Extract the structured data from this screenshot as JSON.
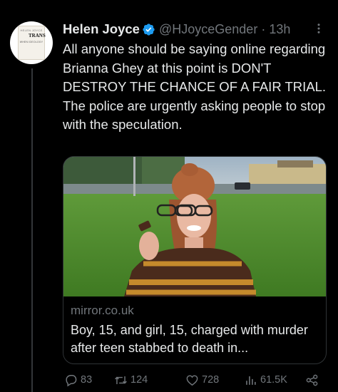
{
  "author": {
    "display_name": "Helen Joyce",
    "handle": "@HJoyceGender",
    "separator": "·",
    "time_ago": "13h",
    "verified": true,
    "avatar": {
      "book_top": "HELEN JOYCE",
      "book_title": "TRANS",
      "book_bottom": "WHEN IDEOLOGY"
    }
  },
  "tweet": {
    "text": "All anyone should be saying online regarding Brianna Ghey at this point is DON'T DESTROY THE CHANCE OF A FAIR TRIAL. The police are urgently asking people to stop with the speculation."
  },
  "card": {
    "domain": "mirror.co.uk",
    "title": "Boy, 15, and girl, 15, charged with murder after teen stabbed to death in..."
  },
  "actions": {
    "replies": "83",
    "retweets": "124",
    "likes": "728",
    "views": "61.5K"
  },
  "colors": {
    "background": "#000000",
    "text": "#e7e9ea",
    "muted": "#71767b",
    "verified": "#1d9bf0",
    "border": "#2f3336"
  },
  "icons": [
    "verified-badge-icon",
    "more-icon",
    "reply-icon",
    "retweet-icon",
    "like-icon",
    "views-icon",
    "share-icon"
  ]
}
